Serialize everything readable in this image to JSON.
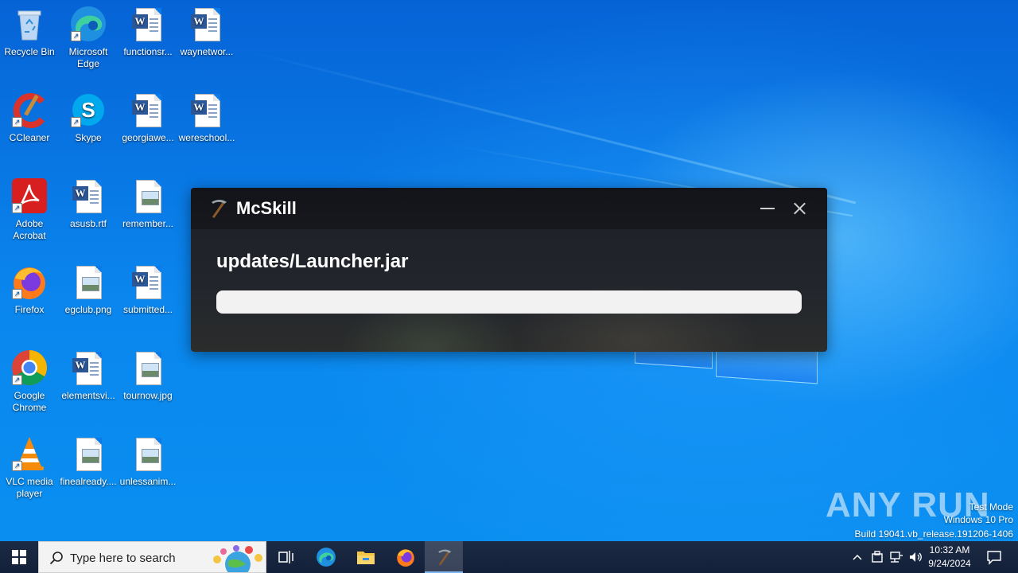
{
  "desktop": {
    "icons": [
      {
        "label": "Recycle Bin",
        "icon": "recycle-bin-icon"
      },
      {
        "label": "Microsoft\nEdge",
        "icon": "edge-icon"
      },
      {
        "label": "functionsr...",
        "icon": "word-doc-icon"
      },
      {
        "label": "waynetwor...",
        "icon": "word-doc-icon"
      },
      {
        "label": "CCleaner",
        "icon": "ccleaner-icon"
      },
      {
        "label": "Skype",
        "icon": "skype-icon"
      },
      {
        "label": "georgiawe...",
        "icon": "word-doc-icon"
      },
      {
        "label": "wereschool...",
        "icon": "word-doc-icon"
      },
      {
        "label": "Adobe\nAcrobat",
        "icon": "acrobat-icon"
      },
      {
        "label": "asusb.rtf",
        "icon": "word-doc-icon"
      },
      {
        "label": "remember...",
        "icon": "image-file-icon"
      },
      {
        "label": "Firefox",
        "icon": "firefox-icon"
      },
      {
        "label": "egclub.png",
        "icon": "image-file-icon"
      },
      {
        "label": "submitted...",
        "icon": "word-doc-icon"
      },
      {
        "label": "Google\nChrome",
        "icon": "chrome-icon"
      },
      {
        "label": "elementsvi...",
        "icon": "word-doc-icon"
      },
      {
        "label": "tournow.jpg",
        "icon": "image-file-icon"
      },
      {
        "label": "VLC media\nplayer",
        "icon": "vlc-icon"
      },
      {
        "label": "finealready....",
        "icon": "image-file-icon"
      },
      {
        "label": "unlessanim...",
        "icon": "image-file-icon"
      }
    ]
  },
  "launcher": {
    "title": "McSkill",
    "file": "updates/Launcher.jar",
    "progress": 0
  },
  "watermark": {
    "brand": "ANY RUN",
    "line1": "Test Mode",
    "line2": "Windows 10 Pro",
    "line3": "Build 19041.vb_release.191206-1406"
  },
  "taskbar": {
    "search_placeholder": "Type here to search",
    "time": "10:32 AM",
    "date": "9/24/2024"
  }
}
